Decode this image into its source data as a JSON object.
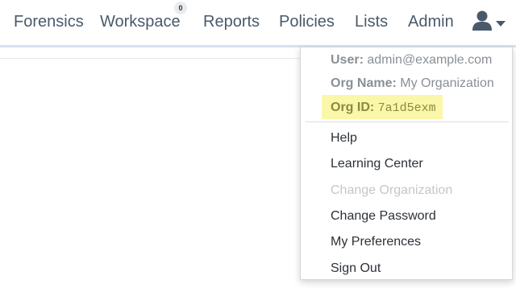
{
  "nav": {
    "items": [
      {
        "label": "Forensics"
      },
      {
        "label": "Workspace",
        "badge": "0"
      },
      {
        "label": "Reports"
      },
      {
        "label": "Policies"
      },
      {
        "label": "Lists"
      },
      {
        "label": "Admin"
      }
    ],
    "user_icon": "user-icon",
    "caret_icon": "caret-down-icon"
  },
  "dropdown": {
    "user_key": "User:",
    "user_value": "admin@example.com",
    "org_name_key": "Org Name:",
    "org_name_value": "My Organization",
    "org_id_key": "Org ID:",
    "org_id_value": "7a1d5exm",
    "menu": [
      {
        "label": "Help",
        "enabled": true
      },
      {
        "label": "Learning Center",
        "enabled": true
      },
      {
        "label": "Change Organization",
        "enabled": false
      },
      {
        "label": "Change Password",
        "enabled": true
      },
      {
        "label": "My Preferences",
        "enabled": true
      },
      {
        "label": "Sign Out",
        "enabled": true
      }
    ]
  },
  "colors": {
    "nav_text": "#4a5a6a",
    "highlight": "#fbf7a9",
    "disabled_text": "#c4c7cb"
  }
}
